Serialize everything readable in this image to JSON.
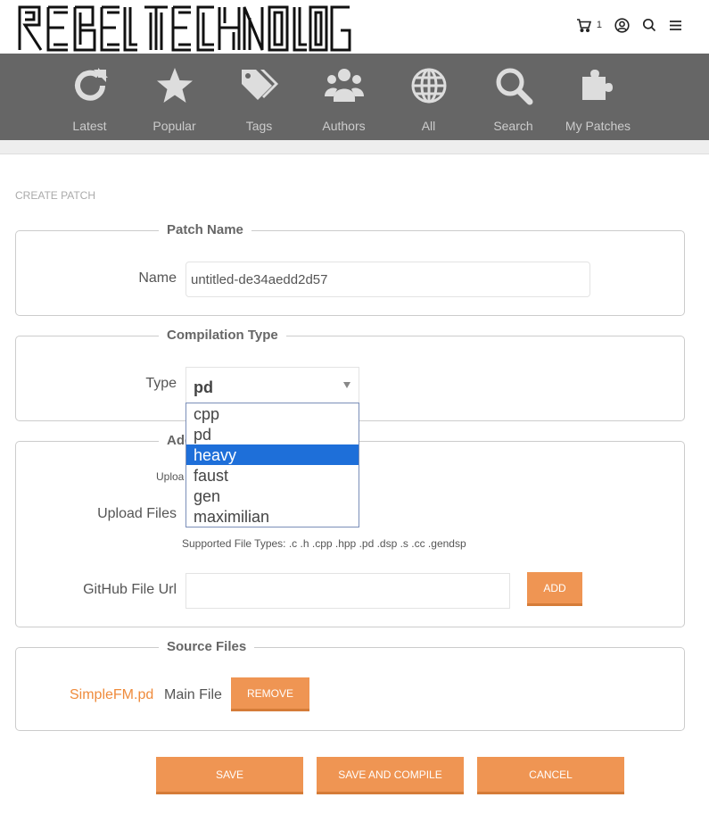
{
  "header": {
    "logo_text": "REBEL TECHNOLOGY",
    "cart_count": "1",
    "icons": [
      "cart-icon",
      "user-icon",
      "search-icon",
      "menu-icon"
    ]
  },
  "nav": {
    "items": [
      {
        "label": "Latest",
        "icon": "refresh-icon"
      },
      {
        "label": "Popular",
        "icon": "star-icon"
      },
      {
        "label": "Tags",
        "icon": "tags-icon"
      },
      {
        "label": "Authors",
        "icon": "users-icon"
      },
      {
        "label": "All",
        "icon": "globe-icon"
      },
      {
        "label": "Search",
        "icon": "search-icon"
      },
      {
        "label": "My Patches",
        "icon": "puzzle-icon"
      }
    ]
  },
  "breadcrumb": "CREATE PATCH",
  "patch_name": {
    "legend": "Patch Name",
    "label": "Name",
    "value": "untitled-de34aedd2d57"
  },
  "compilation": {
    "legend": "Compilation Type",
    "label": "Type",
    "selected": "pd",
    "options": [
      "cpp",
      "pd",
      "heavy",
      "faust",
      "gen",
      "maximilian"
    ],
    "highlighted": "heavy"
  },
  "add_files": {
    "legend_visible": "Add",
    "upload_hint_visible": "Uploa",
    "upload_label": "Upload Files",
    "supported_types": "Supported File Types: .c .h .cpp .hpp .pd .dsp .s .cc .gendsp",
    "github_label": "GitHub File Url",
    "github_value": "",
    "add_button": "ADD"
  },
  "source_files": {
    "legend": "Source Files",
    "files": [
      {
        "name": "SimpleFM.pd",
        "role": "Main File",
        "remove_label": "REMOVE"
      }
    ]
  },
  "actions": {
    "save": "SAVE",
    "save_compile": "SAVE AND COMPILE",
    "cancel": "CANCEL"
  },
  "colors": {
    "accent": "#ef9553",
    "link": "#ef8b3c",
    "nav_bg": "#666666",
    "nav_text": "#cccccc",
    "option_highlight": "#1e6fd9"
  }
}
